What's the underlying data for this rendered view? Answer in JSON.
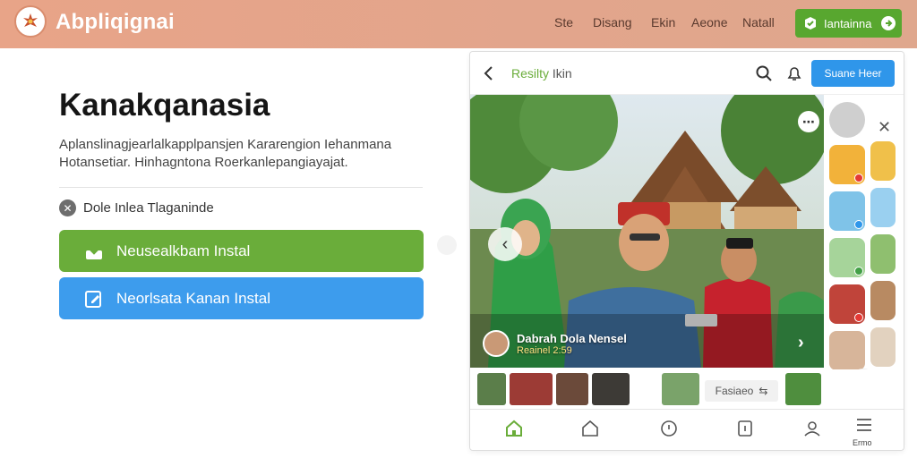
{
  "header": {
    "app_title": "Abpliqignai",
    "nav": [
      "Ste",
      "Disang",
      "Ekin",
      "Aeone",
      "Natall"
    ],
    "cta_label": "Iantainna"
  },
  "hero": {
    "title": "Kanakqanasia",
    "description": "Aplanslinagjearlalkapplpansjen Kararengion Iehanmana Hotansetiar. Hinhagntona Roerkanlepangiayajat.",
    "check_label": "Dole Inlea Tlaganinde",
    "button_primary": "Neusealkbam Instal",
    "button_secondary": "Neorlsata Kanan Instal"
  },
  "phone": {
    "title_green": "Resilty",
    "title_rest": "Ikin",
    "top_button": "Suane Heer",
    "post_user": "Dabrah Dola Nensel",
    "post_sub": "Reainel 2:59",
    "tag_label": "Fasiaeo",
    "bottom_nav_last": "Ermo"
  },
  "icons": [
    "logo-emblem",
    "check-badge-icon",
    "arrow-right-icon",
    "x-circle-icon",
    "download-icon",
    "edit-icon",
    "back-icon",
    "search-icon",
    "bell-icon",
    "chevron-left-icon",
    "chevron-right-icon",
    "more-icon",
    "close-icon",
    "refresh-icon",
    "home-icon",
    "home-outline-icon",
    "compass-icon",
    "share-icon",
    "user-icon",
    "menu-icon"
  ],
  "colors": {
    "header_bg": "#e6a58a",
    "green": "#6aad3a",
    "blue": "#3d9ced",
    "header_btn": "#58a72f"
  }
}
